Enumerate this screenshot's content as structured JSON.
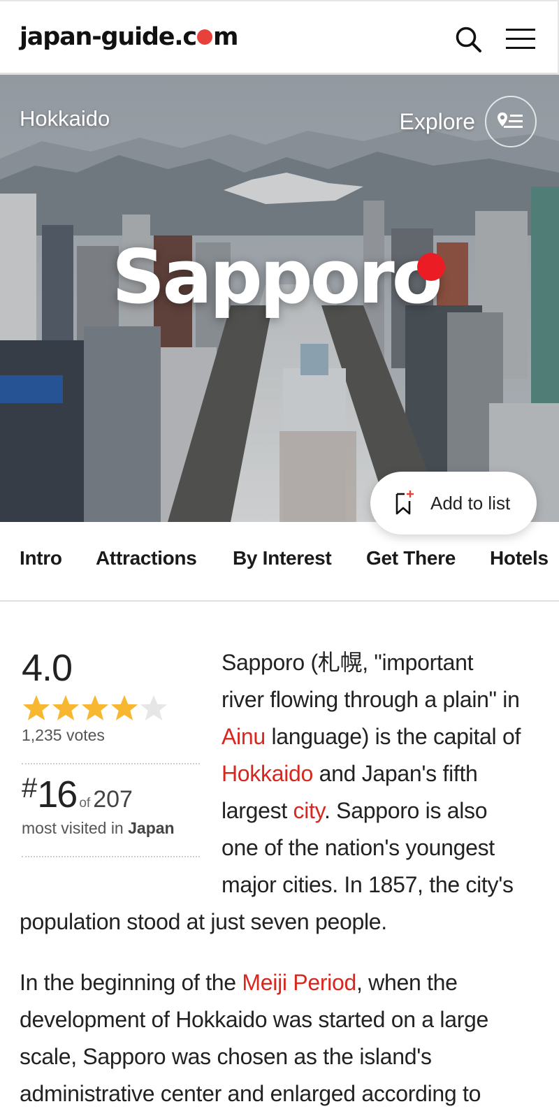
{
  "header": {
    "logo_prefix": "japan-guide.c",
    "logo_suffix": "m"
  },
  "hero": {
    "breadcrumb": "Hokkaido",
    "explore_label": "Explore",
    "city": "Sapporo",
    "add_to_list": "Add to list",
    "colors": {
      "accent": "#ec1c24"
    }
  },
  "tabs": [
    "Intro",
    "Attractions",
    "By Interest",
    "Get There",
    "Hotels"
  ],
  "rating": {
    "score": "4.0",
    "stars": 4,
    "max_stars": 5,
    "votes": "1,235 votes"
  },
  "rank": {
    "hash": "#",
    "position": "16",
    "of": "of",
    "total": "207",
    "sub_prefix": "most visited in",
    "country": "Japan"
  },
  "intro": {
    "p1": [
      "Sapporo (札幌, \"important",
      "river flowing through a plain\" in",
      [
        "Ainu",
        " language) is the capital of"
      ],
      [
        "Hokkaido",
        " and Japan's fifth"
      ],
      [
        "largest ",
        "city",
        ". Sapporo is also"
      ],
      "one of the nation's youngest",
      "major cities. In 1857, the city's",
      "population stood at just seven people."
    ],
    "p2_line1_pre": "In the beginning of the ",
    "p2_line1_link": "Meiji Period",
    "p2_line1_post": ", when the",
    "p2_line2": "development of Hokkaido was started on a large",
    "p2_line3": "scale, Sapporo was chosen as the island's",
    "p2_line4": "administrative center and enlarged according to",
    "link_ainu": "Ainu",
    "link_hokkaido": "Hokkaido",
    "link_city": "city"
  }
}
